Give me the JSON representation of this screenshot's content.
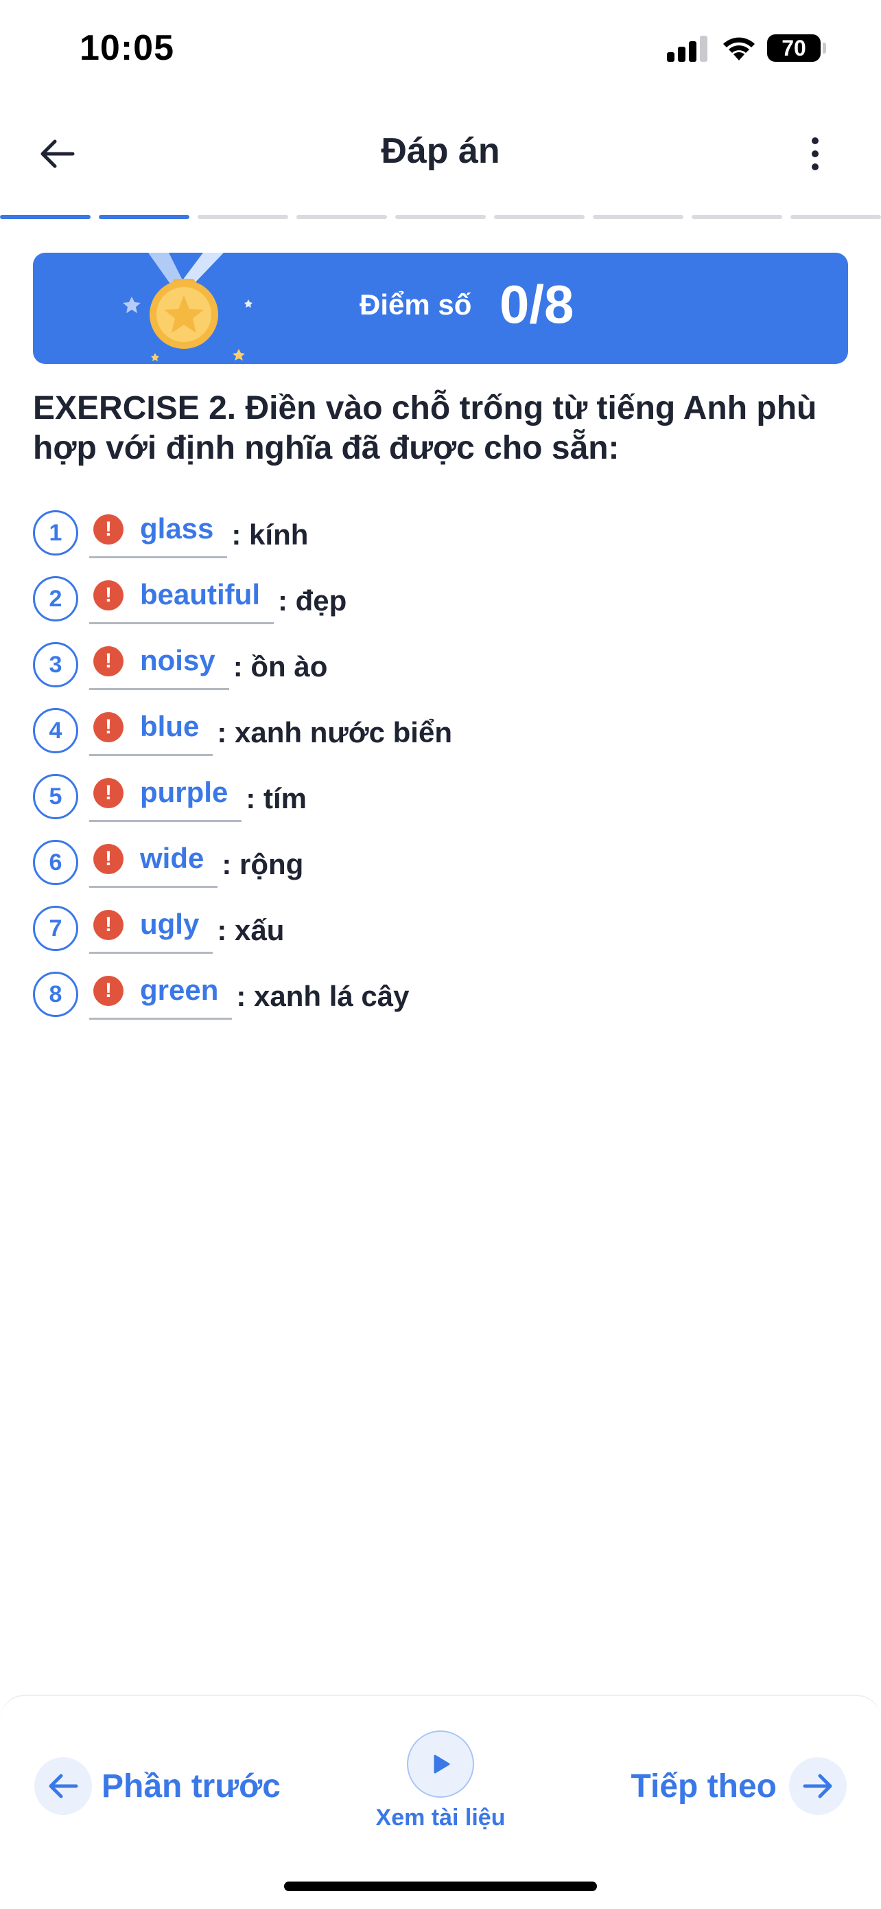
{
  "status_bar": {
    "time": "10:05",
    "battery": "70"
  },
  "header": {
    "title": "Đáp án"
  },
  "progress": {
    "total_steps": 9,
    "completed_steps": 2
  },
  "score": {
    "label": "Điểm số",
    "value": "0/8"
  },
  "exercise": {
    "title": "EXERCISE 2. Điền vào chỗ trống từ tiếng Anh phù hợp với định nghĩa đã được cho sẵn:",
    "items": [
      {
        "number": "1",
        "answer": "glass",
        "definition": ": kính"
      },
      {
        "number": "2",
        "answer": "beautiful",
        "definition": ": đẹp"
      },
      {
        "number": "3",
        "answer": "noisy",
        "definition": ": ồn ào"
      },
      {
        "number": "4",
        "answer": "blue",
        "definition": ": xanh nước biển"
      },
      {
        "number": "5",
        "answer": "purple",
        "definition": ": tím"
      },
      {
        "number": "6",
        "answer": "wide",
        "definition": ": rộng"
      },
      {
        "number": "7",
        "answer": "ugly",
        "definition": ": xấu"
      },
      {
        "number": "8",
        "answer": "green",
        "definition": ": xanh lá cây"
      }
    ]
  },
  "bottom_bar": {
    "prev_label": "Phần trước",
    "docs_label": "Xem tài liệu",
    "next_label": "Tiếp theo"
  },
  "colors": {
    "accent": "#3b78e7",
    "error": "#e0543e",
    "text": "#1f2433"
  }
}
